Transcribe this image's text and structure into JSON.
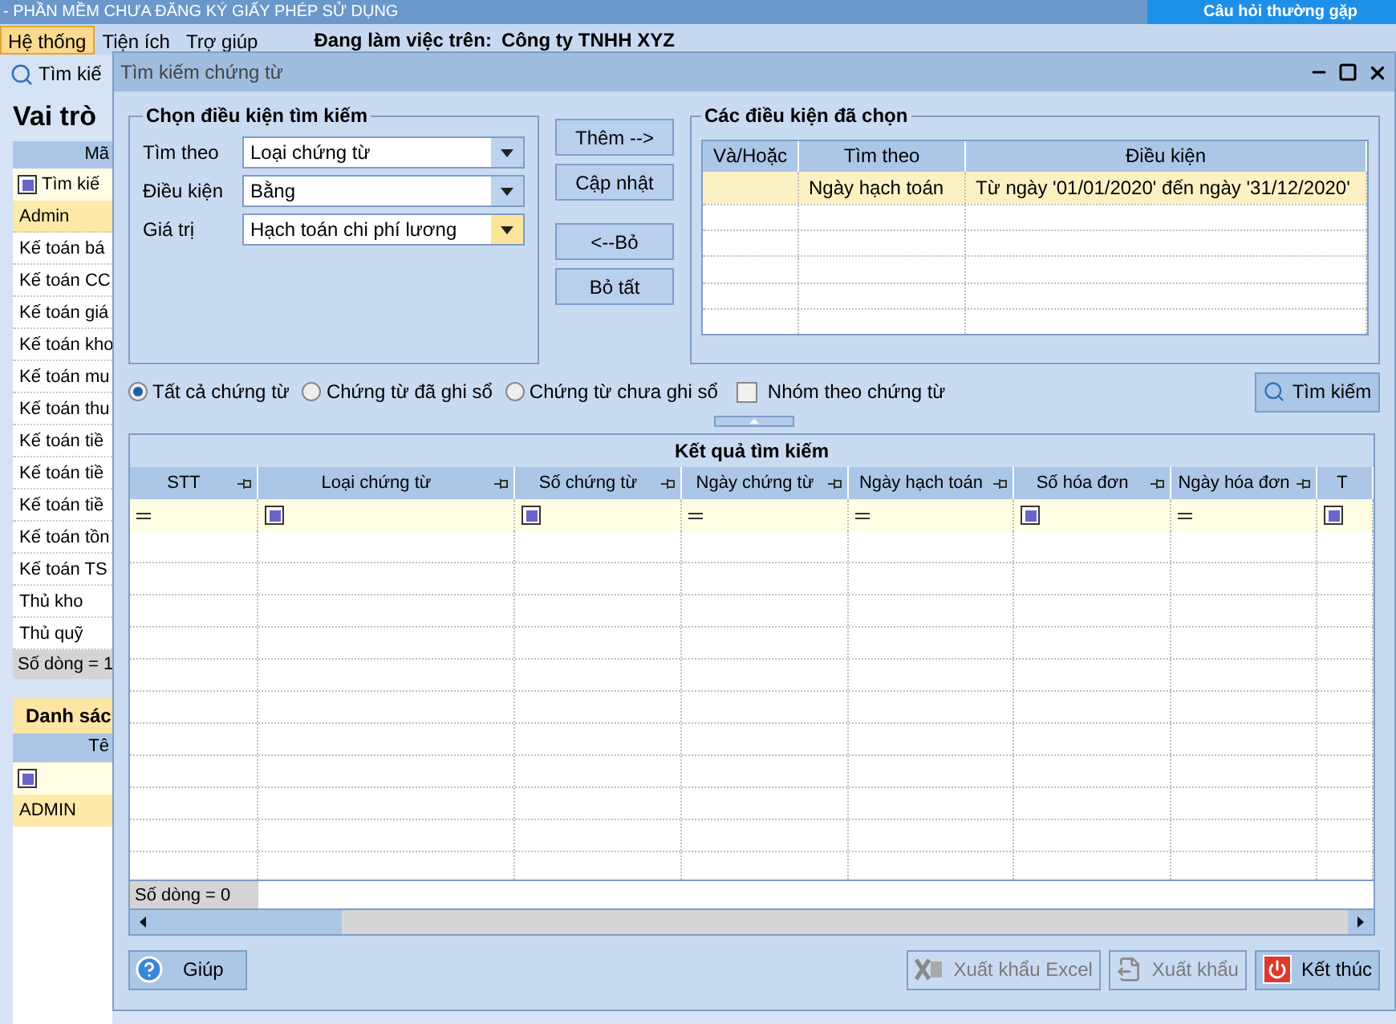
{
  "app_title": "- PHẦN MỀM CHƯA ĐĂNG KÝ GIẤY PHÉP SỬ DỤNG",
  "help_link": "Câu hỏi thường gặp",
  "menu": [
    {
      "label": "Hệ thống",
      "selected": true
    },
    {
      "label": "Tiện ích",
      "selected": false
    },
    {
      "label": "Trợ giúp",
      "selected": false
    }
  ],
  "workspace": {
    "label": "Đang làm việc trên:",
    "company": "Công ty TNHH XYZ"
  },
  "background": {
    "tab": "Tìm kiế",
    "roles": {
      "title": "Vai trò",
      "column": "Mã",
      "filter": "Tìm kiế",
      "footer": "Số dòng = 1",
      "rows": [
        {
          "label": "Admin",
          "selected": true
        },
        {
          "label": "Kế toán bá",
          "selected": false
        },
        {
          "label": "Kế toán CC",
          "selected": false
        },
        {
          "label": "Kế toán giá",
          "selected": false
        },
        {
          "label": "Kế toán kho",
          "selected": false
        },
        {
          "label": "Kế toán mu",
          "selected": false
        },
        {
          "label": "Kế toán thu",
          "selected": false
        },
        {
          "label": "Kế toán tiề",
          "selected": false
        },
        {
          "label": "Kế toán tiề",
          "selected": false
        },
        {
          "label": "Kế toán tiề",
          "selected": false
        },
        {
          "label": "Kế toán tồn",
          "selected": false
        },
        {
          "label": "Kế toán TS",
          "selected": false
        },
        {
          "label": "Thủ kho",
          "selected": false
        },
        {
          "label": "Thủ quỹ",
          "selected": false
        }
      ]
    },
    "list": {
      "title": "Danh sác",
      "column": "Tê",
      "rows": [
        {
          "label": "ADMIN",
          "selected": true
        }
      ]
    }
  },
  "dialog": {
    "title": "Tìm kiếm chứng từ",
    "criteria": {
      "title": "Chọn điều kiện tìm kiếm",
      "fields": [
        {
          "label": "Tìm theo",
          "value": "Loại chứng từ",
          "highlighted": false
        },
        {
          "label": "Điều kiện",
          "value": "Bằng",
          "highlighted": false
        },
        {
          "label": "Giá trị",
          "value": "Hạch toán chi phí lương",
          "highlighted": true
        }
      ]
    },
    "actions": [
      "Thêm -->",
      "Cập nhật",
      "<--Bỏ",
      "Bỏ tất"
    ],
    "selected_conditions": {
      "title": "Các điều kiện đã chọn",
      "columns": [
        "Và/Hoặc",
        "Tìm theo",
        "Điều kiện"
      ],
      "rows": [
        {
          "cells": [
            "",
            "Ngày hạch toán",
            "Từ ngày '01/01/2020' đến ngày '31/12/2020'"
          ],
          "selected": true
        }
      ]
    },
    "scope": [
      {
        "label": "Tất cả chứng từ",
        "selected": true
      },
      {
        "label": "Chứng từ đã ghi sổ",
        "selected": false
      },
      {
        "label": "Chứng từ chưa ghi sổ",
        "selected": false
      }
    ],
    "group_by": {
      "label": "Nhóm theo chứng từ",
      "checked": false
    },
    "search_button": "Tìm kiếm",
    "results": {
      "title": "Kết quả tìm kiếm",
      "footer": "Số dòng = 0",
      "columns": [
        {
          "label": "STT",
          "kind": "equals"
        },
        {
          "label": "Loại chứng từ",
          "kind": "box"
        },
        {
          "label": "Số chứng từ",
          "kind": "box"
        },
        {
          "label": "Ngày chứng từ",
          "kind": "equals"
        },
        {
          "label": "Ngày hạch toán",
          "kind": "equals"
        },
        {
          "label": "Số hóa đơn",
          "kind": "box"
        },
        {
          "label": "Ngày hóa đơn",
          "kind": "equals"
        },
        {
          "label": "T",
          "kind": "box"
        }
      ]
    },
    "help_button": "Giúp",
    "footer_buttons": [
      {
        "label": "Xuất khẩu Excel",
        "kind": "excel",
        "disabled": true
      },
      {
        "label": "Xuất khẩu",
        "kind": "export",
        "disabled": true
      },
      {
        "label": "Kết thúc",
        "kind": "close",
        "disabled": false
      }
    ]
  }
}
